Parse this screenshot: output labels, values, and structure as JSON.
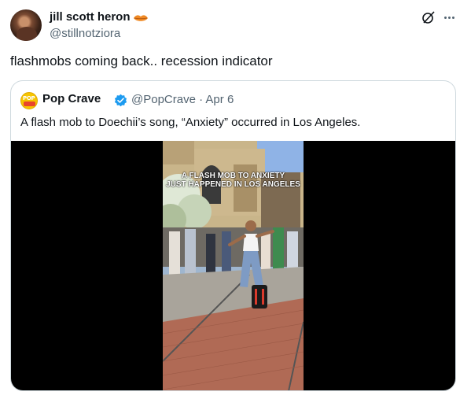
{
  "tweet": {
    "author_name": "jill scott heron",
    "author_handle": "@stillnotziora",
    "text": "flashmobs coming back.. recession indicator"
  },
  "icons": {
    "author_emoji": "lips-icon",
    "grok": "grok-icon",
    "more": "more-icon",
    "verified": "verified-badge-icon"
  },
  "quote": {
    "author_name": "Pop Crave",
    "avatar_text": "POP",
    "author_handle_date": "@PopCrave · Apr 6",
    "text": "A flash mob to Doechii’s song, “Anxiety” occurred in Los Angeles.",
    "video_caption_line1": "A FLASH MOB TO ANXIETY",
    "video_caption_line2": "JUST HAPPENED IN LOS ANGELES"
  },
  "colors": {
    "verified": "#1d9bf0",
    "secondary_text": "#536471",
    "border": "#cfd9de"
  }
}
